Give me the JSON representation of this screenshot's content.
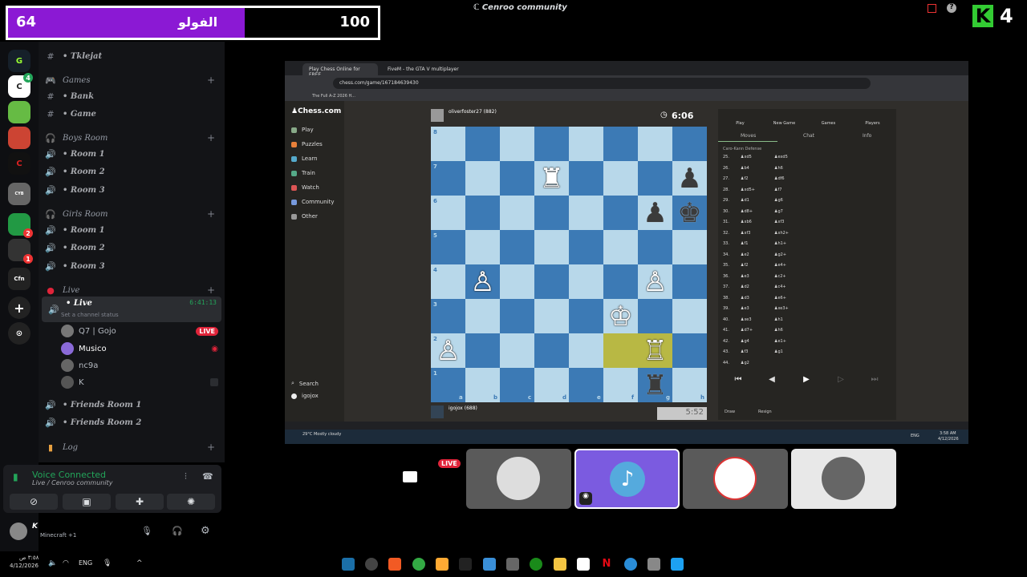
{
  "overlay": {
    "left_count": "64",
    "label": "الفولو",
    "right_count": "100",
    "corner_text": "4",
    "progress_fraction": 0.64
  },
  "window": {
    "title": "Cenroo community"
  },
  "sidebar": {
    "channels": [
      {
        "label": "• Tklejat",
        "type": "text"
      },
      {
        "label": "Games",
        "type": "category"
      },
      {
        "label": "• Bank",
        "type": "text"
      },
      {
        "label": "• Game",
        "type": "text"
      },
      {
        "label": "Boys Room",
        "type": "category"
      },
      {
        "label": "• Room 1",
        "type": "voice"
      },
      {
        "label": "• Room 2",
        "type": "voice"
      },
      {
        "label": "• Room 3",
        "type": "voice"
      },
      {
        "label": "Girls Room",
        "type": "category"
      },
      {
        "label": "• Room 1",
        "type": "voice"
      },
      {
        "label": "• Room 2",
        "type": "voice"
      },
      {
        "label": "• Room 3",
        "type": "voice"
      },
      {
        "label": "Live",
        "type": "category"
      }
    ],
    "live_channel": {
      "label": "• Live",
      "timer": "6:41:13",
      "status": "Set a channel status"
    },
    "members": [
      {
        "name": "Q7 | Gojo",
        "badge": "LIVE"
      },
      {
        "name": "Musico",
        "badge": ""
      },
      {
        "name": "nc9a",
        "badge": ""
      },
      {
        "name": "K",
        "badge": ""
      }
    ],
    "more_channels": [
      {
        "label": "• Friends Room 1"
      },
      {
        "label": "• Friends Room 2"
      },
      {
        "label": "Log",
        "type": "category"
      }
    ]
  },
  "voice": {
    "status": "Voice Connected",
    "location": "Live / Cenroo community"
  },
  "user": {
    "name": "K",
    "activity": "Minecraft +1"
  },
  "stream": {
    "tabs": [
      "Play Chess Online for FREE",
      "FiveM - the GTA V multiplayer"
    ],
    "url": "chess.com/game/167184639430",
    "bookmark": "The Full A-Z 2026 H...",
    "nav": [
      "Play",
      "Puzzles",
      "Learn",
      "Train",
      "Watch",
      "Community",
      "Other"
    ],
    "search": "Search",
    "account": "igojox",
    "opponent": "oliverfoster27 (882)",
    "me": "igojox (688)",
    "clock_top": "6:06",
    "clock_bottom": "5:52",
    "files": [
      "a",
      "b",
      "c",
      "d",
      "e",
      "f",
      "g",
      "h"
    ],
    "ranks": [
      "8",
      "7",
      "6",
      "5",
      "4",
      "3",
      "2",
      "1"
    ],
    "panel_tabs": [
      "Play",
      "New Game",
      "Games",
      "Players"
    ],
    "sub_tabs": [
      "Moves",
      "Chat",
      "Info"
    ],
    "opening": "Caro-Kann Defense",
    "moves": [
      [
        "25.",
        "xd5",
        "exd5"
      ],
      [
        "26.",
        "b4",
        "h6"
      ],
      [
        "27.",
        "f2",
        "df6"
      ],
      [
        "28.",
        "xd5+",
        "f7"
      ],
      [
        "29.",
        "d1",
        "g6"
      ],
      [
        "30.",
        "d8+",
        "g7"
      ],
      [
        "31.",
        "xb6",
        "xf3"
      ],
      [
        "32.",
        "xf3",
        "xh2+"
      ],
      [
        "33.",
        "f1",
        "h1+"
      ],
      [
        "34.",
        "e2",
        "g2+"
      ],
      [
        "35.",
        "f2",
        "e4+"
      ],
      [
        "36.",
        "e3",
        "c2+"
      ],
      [
        "37.",
        "d2",
        "c4+"
      ],
      [
        "38.",
        "d3",
        "e6+"
      ],
      [
        "39.",
        "e3",
        "xe3+"
      ],
      [
        "40.",
        "xe3",
        "h1"
      ],
      [
        "41.",
        "d7+",
        "h6"
      ],
      [
        "42.",
        "g4",
        "e1+"
      ],
      [
        "43.",
        "f3",
        "g1"
      ],
      [
        "44.",
        "g2",
        ""
      ]
    ],
    "draw": "Draw",
    "resign": "Resign",
    "weather": "29°C Mostly cloudy",
    "time": "3:58 AM",
    "date": "4/12/2026",
    "lang": "ENG"
  },
  "taskbar": {
    "time": "٣:٥٨ ص",
    "date": "4/12/2026",
    "lang": "ENG"
  },
  "tiles": [
    "screen share",
    "avatar",
    "Musico",
    "avatar",
    "avatar"
  ],
  "colors": {
    "accent": "#8b19d4",
    "green": "#23a55a",
    "live_red": "#e0243a"
  }
}
